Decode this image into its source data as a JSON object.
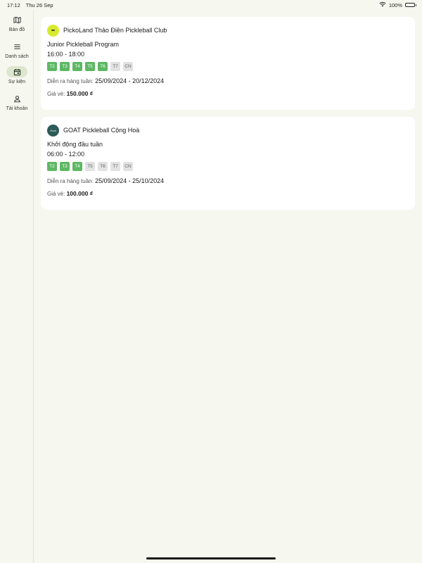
{
  "status_bar": {
    "time": "17:12",
    "date": "Thu 26 Sep",
    "battery": "100%"
  },
  "nav": [
    {
      "label": "Bản đồ",
      "icon": "map-icon",
      "active": false
    },
    {
      "label": "Danh sách",
      "icon": "list-icon",
      "active": false
    },
    {
      "label": "Sự kiện",
      "icon": "calendar-icon",
      "active": true
    },
    {
      "label": "Tài khoản",
      "icon": "person-icon",
      "active": false
    }
  ],
  "events": [
    {
      "club": "PickoLand Thảo Điền Pickleball Club",
      "logo": "pickleball-ball-logo",
      "program": "Junior Pickleball Program",
      "time": "16:00 - 18:00",
      "days": [
        {
          "label": "T2",
          "on": true
        },
        {
          "label": "T3",
          "on": true
        },
        {
          "label": "T4",
          "on": true
        },
        {
          "label": "T5",
          "on": true
        },
        {
          "label": "T6",
          "on": true
        },
        {
          "label": "T7",
          "on": false
        },
        {
          "label": "CN",
          "on": false
        }
      ],
      "schedule_label": "Diễn ra hàng tuần:",
      "schedule_value": "25/09/2024 - 20/12/2024",
      "price_label": "Giá vé:",
      "price_value": "150.000 ₫"
    },
    {
      "club": "GOAT Pickleball Cộng Hoà",
      "logo": "goat-club-logo",
      "logo_text": "Goat",
      "program": "Khởi động đầu tuần",
      "time": "06:00 - 12:00",
      "days": [
        {
          "label": "T2",
          "on": true
        },
        {
          "label": "T3",
          "on": true
        },
        {
          "label": "T4",
          "on": true
        },
        {
          "label": "T5",
          "on": false
        },
        {
          "label": "T6",
          "on": false
        },
        {
          "label": "T7",
          "on": false
        },
        {
          "label": "CN",
          "on": false
        }
      ],
      "schedule_label": "Diễn ra hàng tuần:",
      "schedule_value": "25/09/2024 - 25/10/2024",
      "price_label": "Giá vé:",
      "price_value": "100.000 ₫"
    }
  ],
  "colors": {
    "background": "#f6f7ef",
    "day_active": "#5db863",
    "day_inactive": "#e2e2e2",
    "nav_active": "#dfe6cf"
  }
}
